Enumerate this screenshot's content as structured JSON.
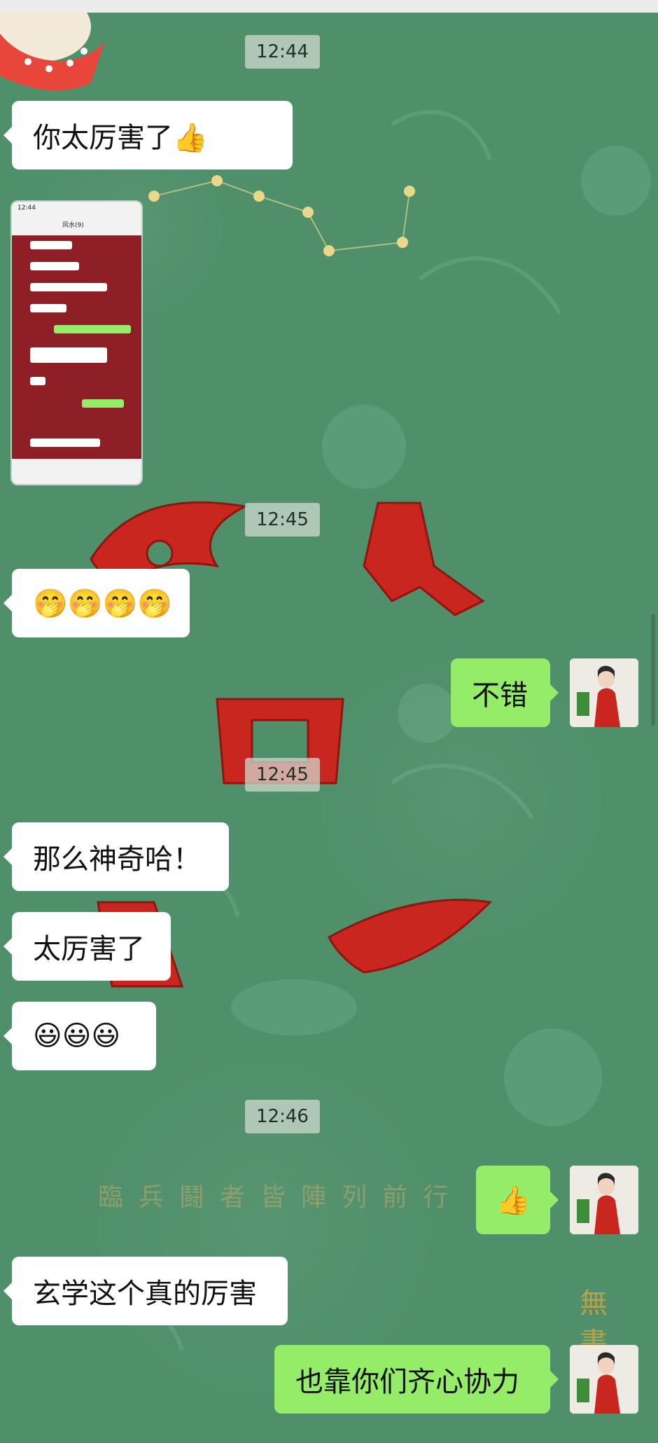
{
  "messages": {
    "t1": "12:44",
    "m1": "你太厉害了👍",
    "t2": "12:45",
    "m2": "🤭🤭🤭🤭",
    "m3": "不错",
    "t3": "12:45",
    "m4": "那么神奇哈！",
    "m5": "太厉害了",
    "m6": "😃😃😃",
    "t4": "12:46",
    "m7": "👍",
    "m8": "玄学这个真的厉害",
    "m9": "也靠你们齐心协力"
  },
  "wallpaper": {
    "line_text": "臨兵鬪者皆陣列前行",
    "vertical_text": "無書"
  },
  "screenshot_preview": {
    "time": "12:44",
    "title": "风水(9)"
  },
  "colors": {
    "background": "#4f8f6a",
    "bubble_sent": "#95ec69",
    "bubble_received": "#ffffff",
    "accent_red": "#c8261e"
  }
}
